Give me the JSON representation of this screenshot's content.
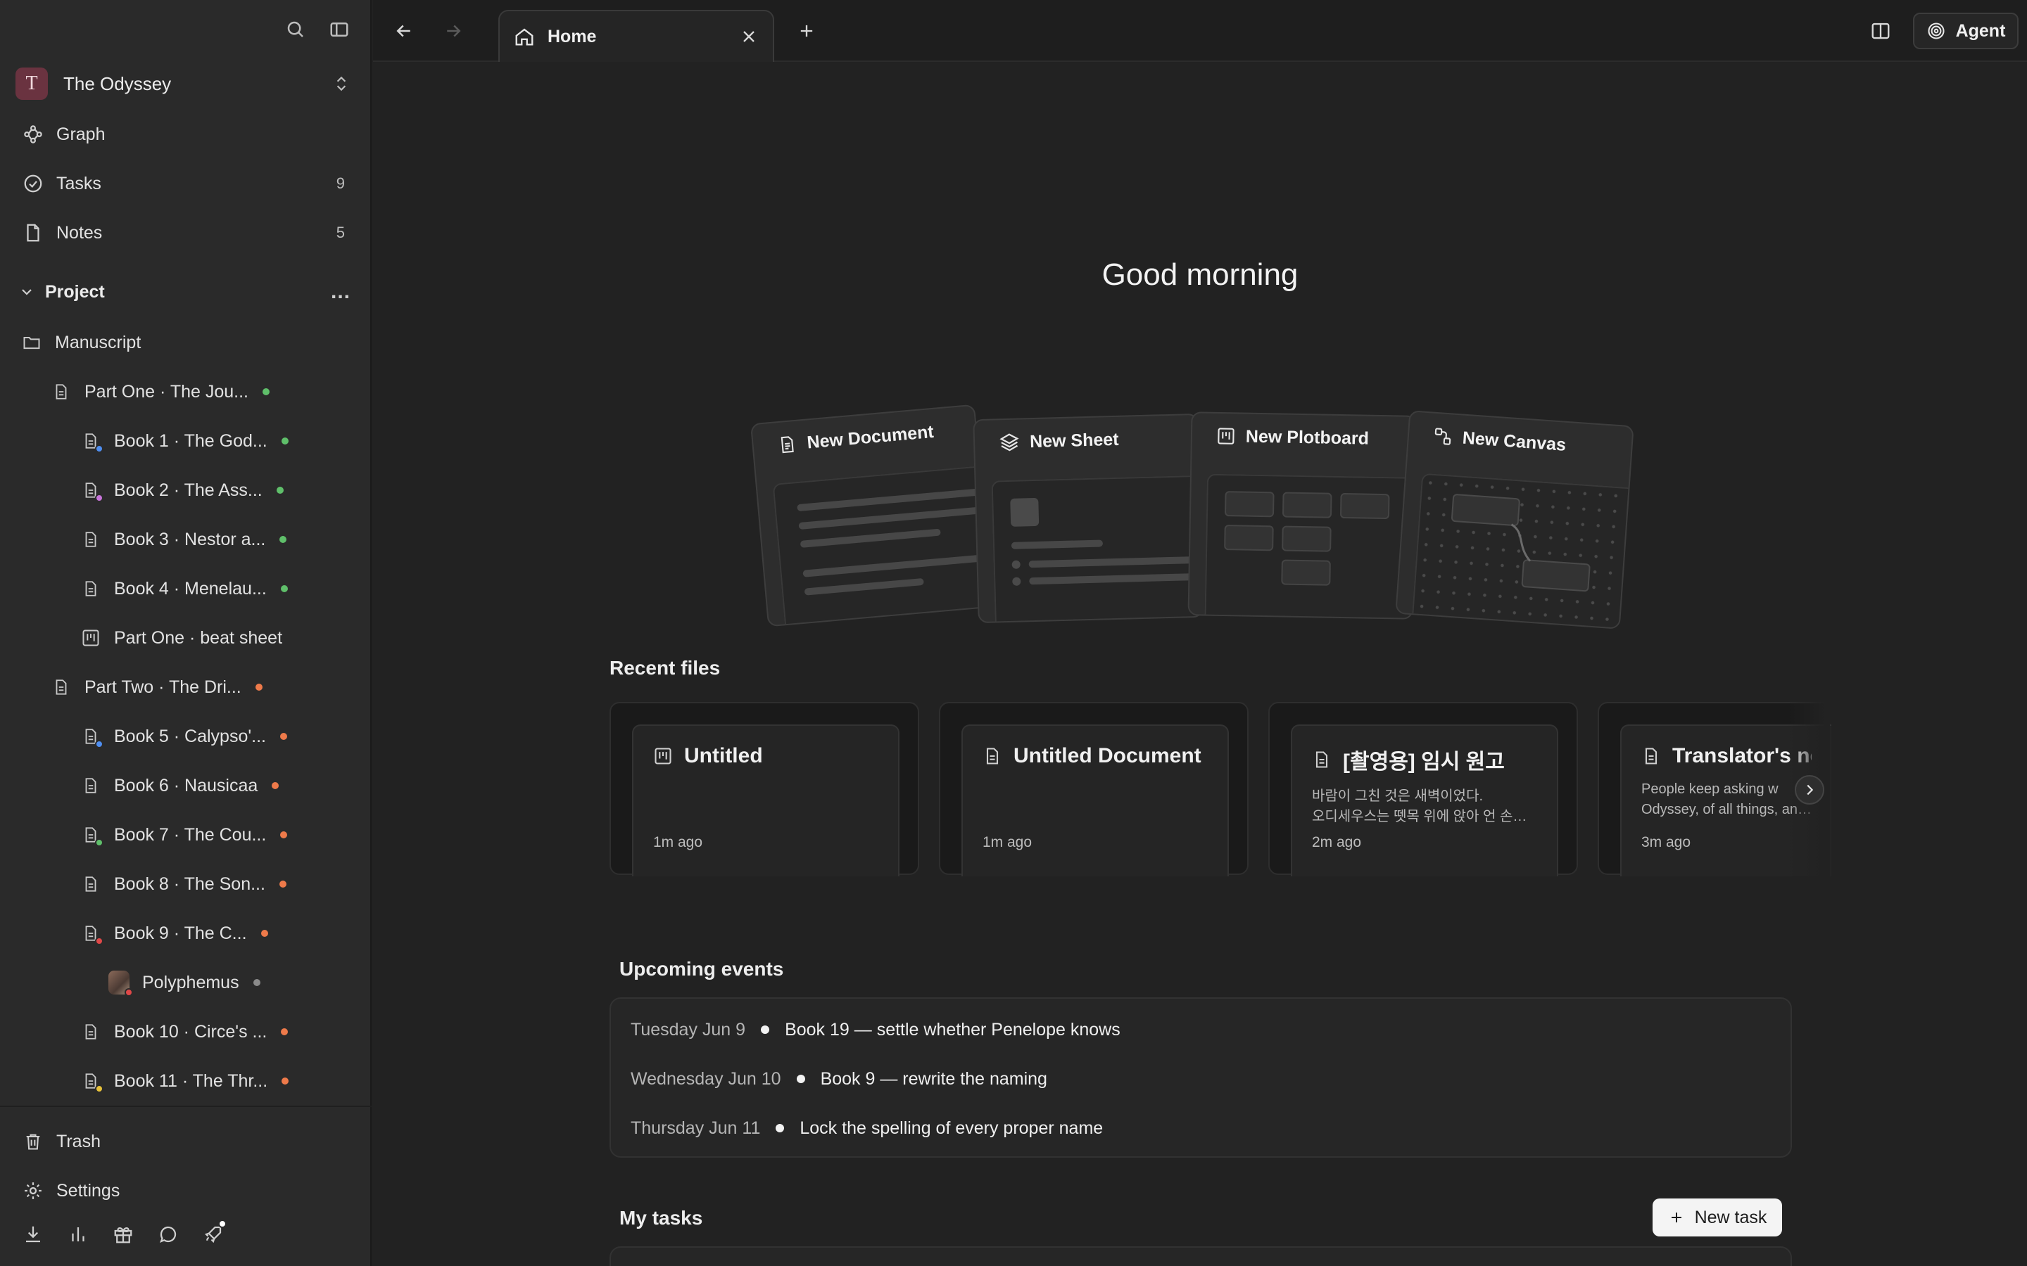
{
  "workspace": {
    "avatar_letter": "T",
    "name": "The Odyssey"
  },
  "nav": {
    "graph": "Graph",
    "tasks": {
      "label": "Tasks",
      "count": "9"
    },
    "notes": {
      "label": "Notes",
      "count": "5"
    }
  },
  "project": {
    "title": "Project",
    "more": "...",
    "items": [
      {
        "label": "Manuscript",
        "icon": "folder-icon"
      },
      {
        "label": "Part One · The Jou...",
        "icon": "document-icon",
        "status_color": "#5fbf6a"
      },
      {
        "label": "Book 1 · The God...",
        "icon": "document-icon",
        "badge_color": "#4f8ef0",
        "status_color": "#5fbf6a"
      },
      {
        "label": "Book 2 · The Ass...",
        "icon": "document-icon",
        "badge_color": "#c774d9",
        "status_color": "#5fbf6a"
      },
      {
        "label": "Book 3 · Nestor a...",
        "icon": "document-icon",
        "status_color": "#5fbf6a"
      },
      {
        "label": "Book 4 · Menelau...",
        "icon": "document-icon",
        "status_color": "#5fbf6a"
      },
      {
        "label": "Part One · beat sheet",
        "icon": "plotboard-icon"
      },
      {
        "label": "Part Two · The Dri...",
        "icon": "document-icon",
        "status_color": "#ee7a4a"
      },
      {
        "label": "Book 5 · Calypso'...",
        "icon": "document-icon",
        "badge_color": "#4f8ef0",
        "status_color": "#ee7a4a"
      },
      {
        "label": "Book 6 · Nausicaa",
        "icon": "document-icon",
        "status_color": "#ee7a4a"
      },
      {
        "label": "Book 7 · The Cou...",
        "icon": "document-icon",
        "badge_color": "#5fbf6a",
        "status_color": "#ee7a4a"
      },
      {
        "label": "Book 8 · The Son...",
        "icon": "document-icon",
        "status_color": "#ee7a4a"
      },
      {
        "label": "Book 9 · The C...",
        "icon": "document-icon",
        "badge_color": "#e04848",
        "status_color": "#ee7a4a"
      },
      {
        "label": "Polyphemus",
        "icon": "image-avatar",
        "badge_color": "#e04848",
        "status_color": "#8a8a8a"
      },
      {
        "label": "Book 10 · Circe's ...",
        "icon": "document-icon",
        "status_color": "#ee7a4a"
      },
      {
        "label": "Book 11 · The Thr...",
        "icon": "document-icon",
        "badge_color": "#e8c23a",
        "status_color": "#ee7a4a"
      }
    ]
  },
  "sidebar_footer": {
    "trash": "Trash",
    "settings": "Settings"
  },
  "topbar": {
    "tab_label": "Home",
    "agent_label": "Agent"
  },
  "main": {
    "greeting": "Good morning",
    "create": {
      "document": "New Document",
      "sheet": "New Sheet",
      "plotboard": "New Plotboard",
      "canvas": "New Canvas"
    },
    "recent_title": "Recent files",
    "recent_files": [
      {
        "title": "Untitled",
        "icon": "plotboard-icon",
        "preview": [
          "",
          ""
        ],
        "time": "1m ago"
      },
      {
        "title": "Untitled Document",
        "icon": "document-icon",
        "preview": [
          "",
          ""
        ],
        "time": "1m ago"
      },
      {
        "title": "[촬영용] 임시 원고",
        "icon": "document-icon",
        "preview": [
          "바람이 그친 것은 새벽이었다.",
          "오디세우스는 뗏목 위에 앉아 언 손을..."
        ],
        "time": "2m ago"
      },
      {
        "title": "Translator's note",
        "icon": "document-icon",
        "preview": [
          "People keep asking w",
          "Odyssey, of all things, and v"
        ],
        "time": "3m ago"
      }
    ],
    "events_title": "Upcoming events",
    "events": [
      {
        "date": "Tuesday Jun 9",
        "title": "Book 19 — settle whether Penelope knows"
      },
      {
        "date": "Wednesday Jun 10",
        "title": "Book 9 — rewrite the naming"
      },
      {
        "date": "Thursday Jun 11",
        "title": "Lock the spelling of every proper name"
      }
    ],
    "tasks_title": "My tasks",
    "new_task_label": "New task"
  }
}
